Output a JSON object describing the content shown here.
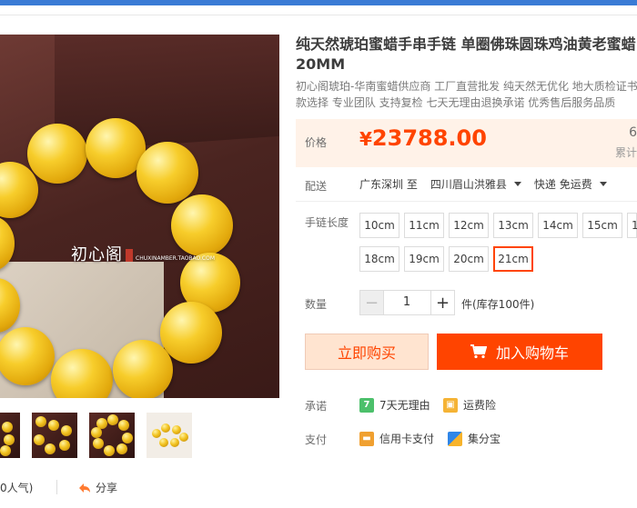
{
  "product": {
    "title_line1": "纯天然琥珀蜜蜡手串手链 单圈佛珠圆珠鸡油黄老蜜蜡",
    "title_line2": "20MM",
    "subtitle_line1": "初心阁琥珀-华南蜜蜡供应商 工厂直营批发 纯天然无优化 地大质检证书",
    "subtitle_line2": "款选择 专业团队 支持复检 七天无理由退换承诺 优秀售后服务品质"
  },
  "gallery": {
    "watermark_brand": "初心阁",
    "watermark_url": "CHUXINAMBER.TAOBAO.COM",
    "popularity": "0人气)",
    "share_label": "分享"
  },
  "price": {
    "label": "价格",
    "currency": "¥",
    "value": "23788.00",
    "right_top": "6",
    "right_bottom": "累计"
  },
  "delivery": {
    "label": "配送",
    "from": "广东深圳",
    "to_word": "至",
    "destination": "四川眉山洪雅县",
    "shipping": "快递 免运费"
  },
  "sku": {
    "label": "手链长度",
    "options": [
      "10cm",
      "11cm",
      "12cm",
      "13cm",
      "14cm",
      "15cm",
      "1",
      "18cm",
      "19cm",
      "20cm",
      "21cm"
    ],
    "selected": "21cm"
  },
  "quantity": {
    "label": "数量",
    "minus": "−",
    "value": "1",
    "plus": "+",
    "stock_text": "件(库存100件)"
  },
  "actions": {
    "buy_now": "立即购买",
    "add_to_cart": "加入购物车"
  },
  "service": {
    "promise_label": "承诺",
    "seven_days_icon": "7",
    "seven_days": "7天无理由",
    "insurance": "运费险",
    "payment_label": "支付",
    "credit_card": "信用卡支付",
    "installment": "集分宝"
  },
  "colors": {
    "accent": "#ff4400",
    "price_bg": "#fff2e8",
    "top_bar": "#3a7bd5"
  }
}
